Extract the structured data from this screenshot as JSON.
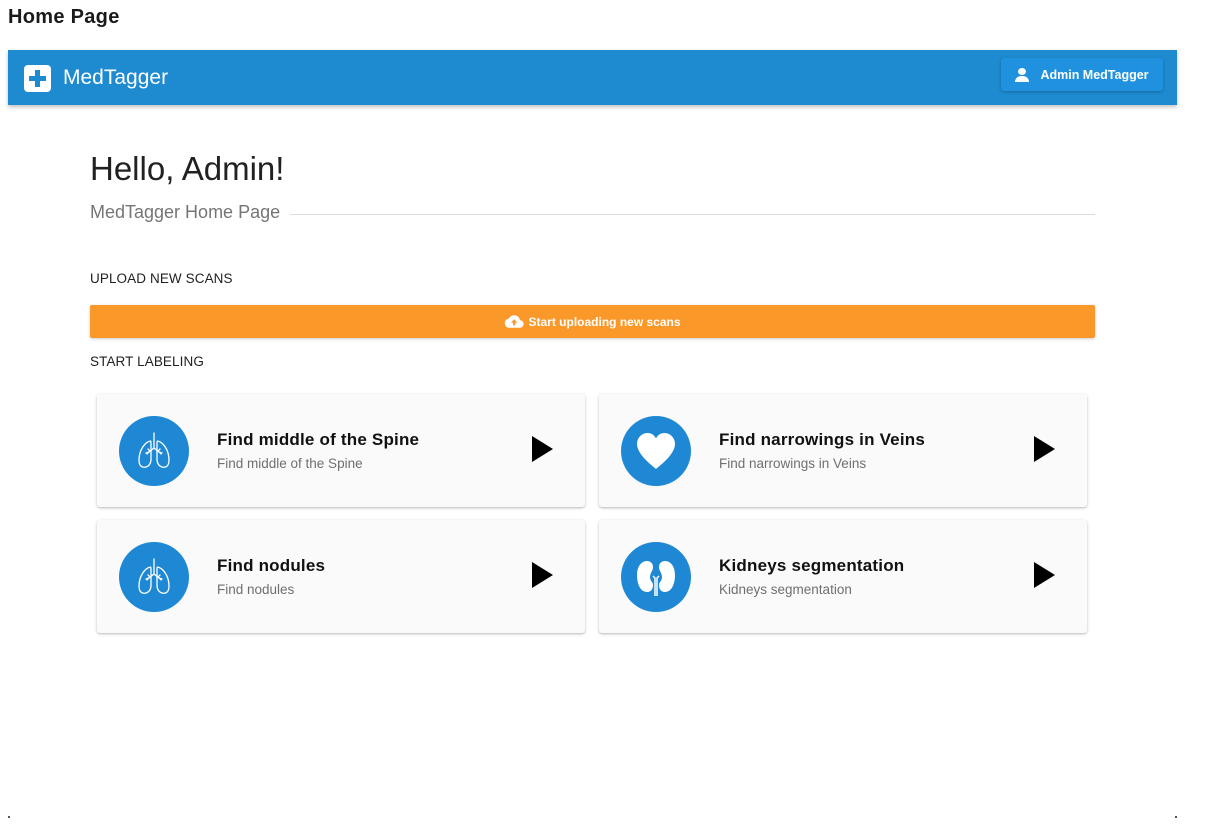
{
  "page_caption": "Home Page",
  "app": {
    "brand_name": "MedTagger",
    "user_button_label": "Admin MedTagger"
  },
  "home": {
    "greeting": "Hello, Admin!",
    "subtitle": "MedTagger Home Page",
    "upload_section_label": "UPLOAD NEW SCANS",
    "upload_button_label": "Start uploading new scans",
    "labeling_section_label": "START LABELING"
  },
  "tasks": [
    {
      "title": "Find middle of the Spine",
      "description": "Find middle of the Spine",
      "icon": "lungs-icon"
    },
    {
      "title": "Find narrowings in Veins",
      "description": "Find narrowings in Veins",
      "icon": "heart-icon"
    },
    {
      "title": "Find nodules",
      "description": "Find nodules",
      "icon": "lungs-icon"
    },
    {
      "title": "Kidneys segmentation",
      "description": "Kidneys segmentation",
      "icon": "kidneys-icon"
    }
  ],
  "colors": {
    "topbar": "#1e8bd1",
    "upload_button": "#fb982a",
    "task_icon_bg": "#1e88d4"
  }
}
